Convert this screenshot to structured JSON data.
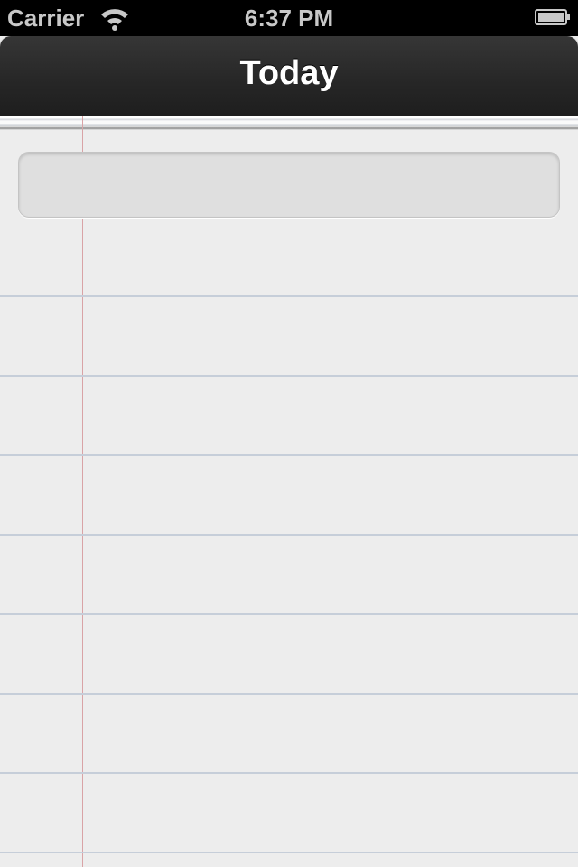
{
  "status_bar": {
    "carrier": "Carrier",
    "time": "6:37 PM",
    "wifi_icon": "wifi-icon",
    "battery_icon": "battery-icon"
  },
  "nav_bar": {
    "title": "Today"
  },
  "main": {
    "new_item_input": {
      "value": "",
      "placeholder": ""
    }
  }
}
